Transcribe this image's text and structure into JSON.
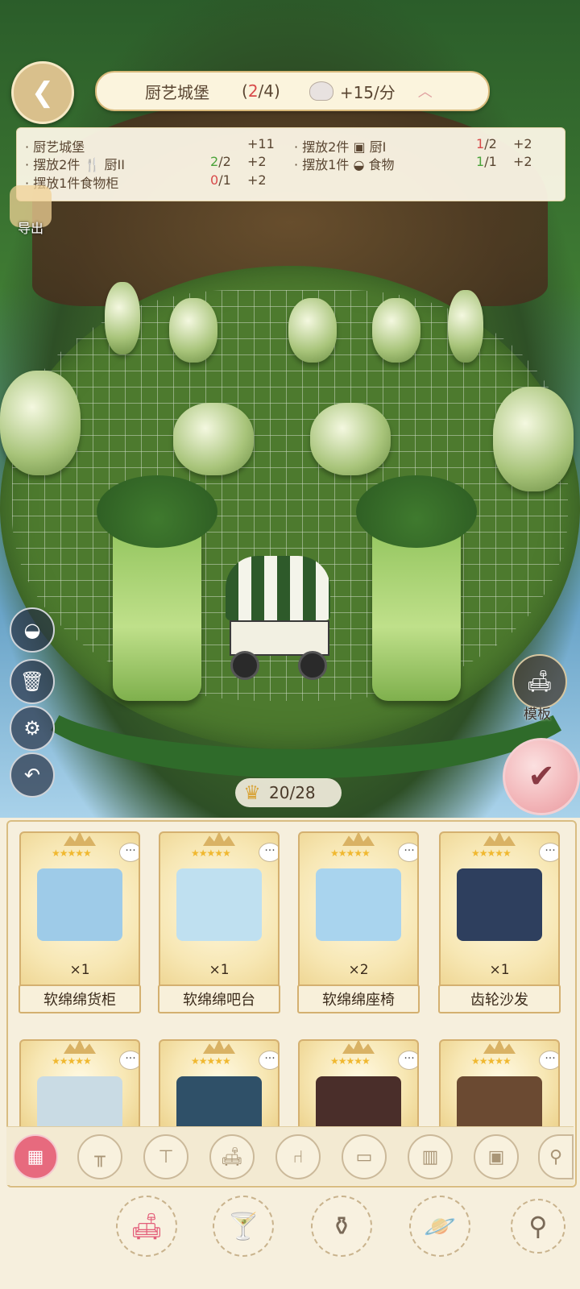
{
  "header": {
    "back_icon": "back-arrow-icon",
    "title": "厨艺城堡",
    "progress_current": "2",
    "progress_text": "(2/4)",
    "rate": "+15/分",
    "rate_icon": "chef-hat-icon",
    "collapse_icon": "chevron-up-icon"
  },
  "info": {
    "row1_left_label": "· 厨艺城堡",
    "row1_left_bonus": "+11",
    "row1_right_label": "· 摆放2件",
    "row1_right_item": "厨I",
    "row1_right_have": "1",
    "row1_right_need": "/2",
    "row1_right_bonus": "+2",
    "row2_left_label": "· 摆放2件",
    "row2_left_item": "厨II",
    "row2_left_have": "2",
    "row2_left_need": "/2",
    "row2_left_bonus": "+2",
    "row2_right_label": "· 摆放1件",
    "row2_right_item": "食物",
    "row2_right_have": "1",
    "row2_right_need": "/1",
    "row2_right_bonus": "+2",
    "row3_left_label": "· 摆放1件食物柜",
    "row3_left_have": "0",
    "row3_left_need": "/1",
    "row3_left_bonus": "+2"
  },
  "left_tools": {
    "export_label": "导出",
    "export_icon": "qr-code-icon",
    "mode_icon": "half-circle-icon",
    "delete_icon": "trash-icon",
    "settings_icon": "gear-icon",
    "undo_icon": "undo-icon"
  },
  "right_tools": {
    "template_label": "模板",
    "template_icon": "sofa-icon",
    "confirm_icon": "checkmark-icon"
  },
  "capacity": {
    "text": "20/28",
    "icon": "throne-icon"
  },
  "items": [
    {
      "name": "软绵绵货柜",
      "qty": "×1",
      "stars": "★★★★★",
      "color": "#9ecbe8"
    },
    {
      "name": "软绵绵吧台",
      "qty": "×1",
      "stars": "★★★★★",
      "color": "#bfe0f0"
    },
    {
      "name": "软绵绵座椅",
      "qty": "×2",
      "stars": "★★★★★",
      "color": "#a9d4ee"
    },
    {
      "name": "齿轮沙发",
      "qty": "×1",
      "stars": "★★★★★",
      "color": "#2e3f5e"
    },
    {
      "stars": "★★★★★",
      "color": "#c9dbe4"
    },
    {
      "stars": "★★★★★",
      "color": "#2f5068"
    },
    {
      "stars": "★★★★★",
      "color": "#4a2e2a"
    },
    {
      "stars": "★★★★★",
      "color": "#6b4a32"
    }
  ],
  "card_more": "···",
  "categories": [
    "grid-all-icon",
    "table-icon",
    "round-table-icon",
    "sofa-icon",
    "chair-icon",
    "bed-icon",
    "cabinet-icon",
    "stove-icon",
    "lamp-icon"
  ],
  "bottom_nav": [
    "furniture-icon",
    "cocktail-icon",
    "vase-icon",
    "planet-icon",
    "search-icon"
  ]
}
